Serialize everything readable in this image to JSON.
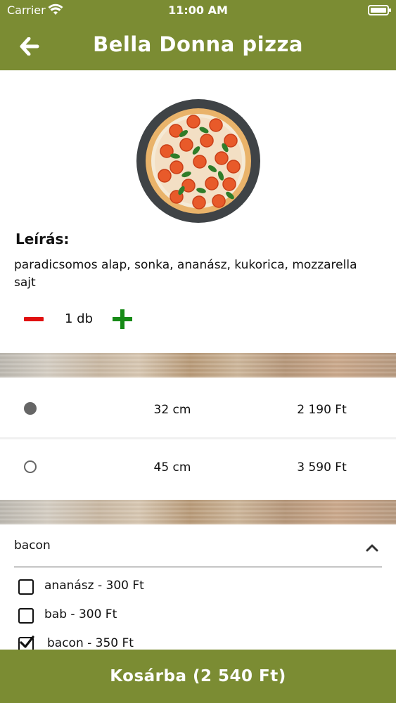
{
  "status_bar": {
    "carrier": "Carrier",
    "time": "11:00 AM"
  },
  "header": {
    "title": "Bella Donna pizza",
    "back_icon": "arrow-left-icon"
  },
  "product": {
    "image": "pizza-image",
    "description_label": "Leírás:",
    "description": "paradicsomos alap, sonka, ananász, kukorica, mozzarella sajt"
  },
  "quantity": {
    "value": "1 db",
    "minus_icon": "minus-icon",
    "plus_icon": "plus-icon",
    "minus_color": "#e01010",
    "plus_color": "#168a16"
  },
  "sizes": [
    {
      "size": "32 cm",
      "price": "2 190 Ft",
      "selected": true
    },
    {
      "size": "45 cm",
      "price": "3 590 Ft",
      "selected": false
    }
  ],
  "extras": {
    "category": "bacon",
    "expanded": true,
    "options": [
      {
        "label": "ananász - 300 Ft",
        "checked": false
      },
      {
        "label": "bab - 300 Ft",
        "checked": false
      },
      {
        "label": "bacon - 350 Ft",
        "checked": true
      }
    ]
  },
  "cart_button": {
    "label": "Kosárba (2 540 Ft)"
  },
  "colors": {
    "brand": "#7b8c33"
  }
}
